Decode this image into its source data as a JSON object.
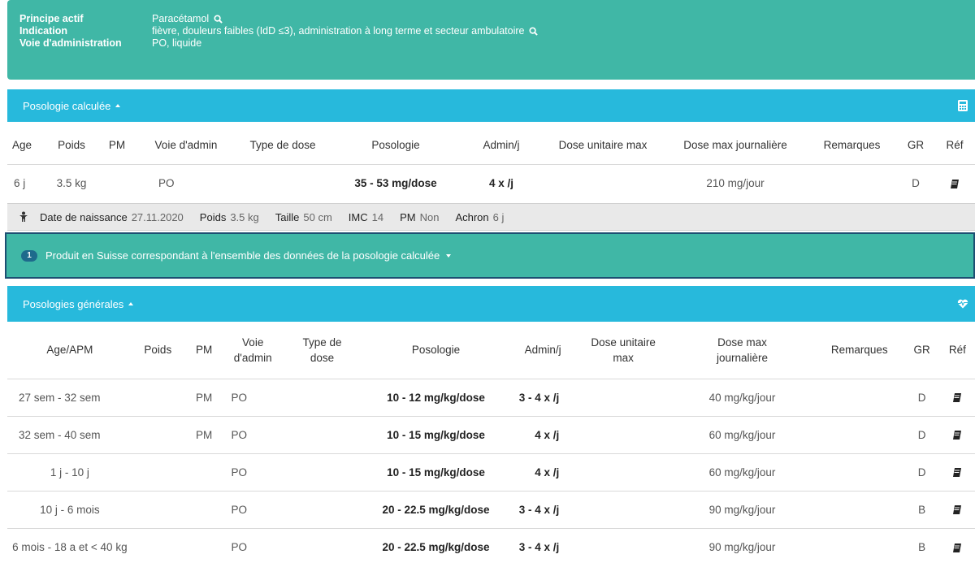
{
  "drug": {
    "principe_label": "Principe actif",
    "principe_value": "Paracétamol",
    "indication_label": "Indication",
    "indication_value": "fièvre, douleurs faibles (IdD ≤3), administration à long terme et secteur ambulatoire",
    "voie_label": "Voie d'administration",
    "voie_value": "PO, liquide"
  },
  "calc_panel": {
    "title": "Posologie calculée",
    "icon": "calculator-icon",
    "headers": [
      "Age",
      "Poids",
      "PM",
      "Voie d'admin",
      "Type de dose",
      "Posologie",
      "Admin/j",
      "Dose unitaire max",
      "Dose max journalière",
      "Remarques",
      "GR",
      "Réf"
    ],
    "row": {
      "age": "6 j",
      "poids": "3.5 kg",
      "pm": "",
      "voie": "PO",
      "type": "",
      "posologie": "35 - 53 mg/dose",
      "admin": "4 x /j",
      "dose_unit_max": "",
      "dose_max_jour": "210 mg/jour",
      "remarques": "",
      "gr": "D",
      "ref_icon": "book-icon"
    }
  },
  "patient": {
    "icon": "person-icon",
    "dob_label": "Date de naissance",
    "dob_value": "27.11.2020",
    "poids_label": "Poids",
    "poids_value": "3.5 kg",
    "taille_label": "Taille",
    "taille_value": "50 cm",
    "imc_label": "IMC",
    "imc_value": "14",
    "pm_label": "PM",
    "pm_value": "Non",
    "achron_label": "Achron",
    "achron_value": "6 j"
  },
  "product_bar": {
    "count": "1",
    "text": "Produit en Suisse correspondant à l'ensemble des données de la posologie calculée"
  },
  "gen_panel": {
    "title": "Posologies générales",
    "icon": "heart-pulse-icon",
    "headers": {
      "age": "Age/APM",
      "poids": "Poids",
      "pm": "PM",
      "voie_1": "Voie",
      "voie_2": "d'admin",
      "type_1": "Type de",
      "type_2": "dose",
      "posologie": "Posologie",
      "admin": "Admin/j",
      "dum_1": "Dose unitaire",
      "dum_2": "max",
      "dmj_1": "Dose max",
      "dmj_2": "journalière",
      "remarques": "Remarques",
      "gr": "GR",
      "ref": "Réf"
    },
    "rows": [
      {
        "age": "27 sem - 32 sem",
        "pm": "PM",
        "voie": "PO",
        "posologie": "10 - 12 mg/kg/dose",
        "admin": "3 - 4 x /j",
        "dmj": "40 mg/kg/jour",
        "gr": "D"
      },
      {
        "age": "32 sem - 40 sem",
        "pm": "PM",
        "voie": "PO",
        "posologie": "10 - 15 mg/kg/dose",
        "admin": "4 x /j",
        "dmj": "60 mg/kg/jour",
        "gr": "D"
      },
      {
        "age": "1 j - 10 j",
        "pm": "",
        "voie": "PO",
        "posologie": "10 - 15 mg/kg/dose",
        "admin": "4 x /j",
        "dmj": "60 mg/kg/jour",
        "gr": "D"
      },
      {
        "age": "10 j - 6 mois",
        "pm": "",
        "voie": "PO",
        "posologie": "20 - 22.5 mg/kg/dose",
        "admin": "3 - 4 x /j",
        "dmj": "90 mg/kg/jour",
        "gr": "B"
      },
      {
        "age": "6 mois - 18 a et < 40 kg",
        "pm": "",
        "voie": "PO",
        "posologie": "20 - 22.5 mg/kg/dose",
        "admin": "3 - 4 x /j",
        "dmj": "90 mg/kg/jour",
        "gr": "B"
      }
    ]
  },
  "colors": {
    "teal": "#40b7a6",
    "blue": "#27b9dc",
    "navy_border": "#1d4f72",
    "patient_bar": "#e9e9e9"
  }
}
